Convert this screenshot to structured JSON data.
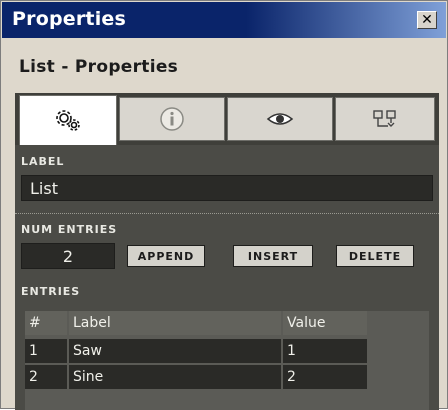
{
  "window": {
    "title": "Properties",
    "close_glyph": "✕"
  },
  "subtitle": "List - Properties",
  "tabs": [
    {
      "name": "settings",
      "icon": "gears-icon",
      "active": true
    },
    {
      "name": "info",
      "icon": "info-icon",
      "active": false
    },
    {
      "name": "view",
      "icon": "eye-icon",
      "active": false
    },
    {
      "name": "connections",
      "icon": "connection-icon",
      "active": false
    }
  ],
  "label_section": {
    "header": "LABEL",
    "value": "List"
  },
  "num_entries_section": {
    "header": "NUM ENTRIES",
    "value": "2",
    "append_label": "APPEND",
    "insert_label": "INSERT",
    "delete_label": "DELETE"
  },
  "entries_section": {
    "header": "ENTRIES",
    "columns": [
      "#",
      "Label",
      "Value"
    ],
    "rows": [
      {
        "index": "1",
        "label": "Saw",
        "value": "1"
      },
      {
        "index": "2",
        "label": "Sine",
        "value": "2"
      }
    ]
  },
  "colors": {
    "titlebar": "#0a246a",
    "panel": "#4b4b46",
    "field": "#2a2a27"
  }
}
